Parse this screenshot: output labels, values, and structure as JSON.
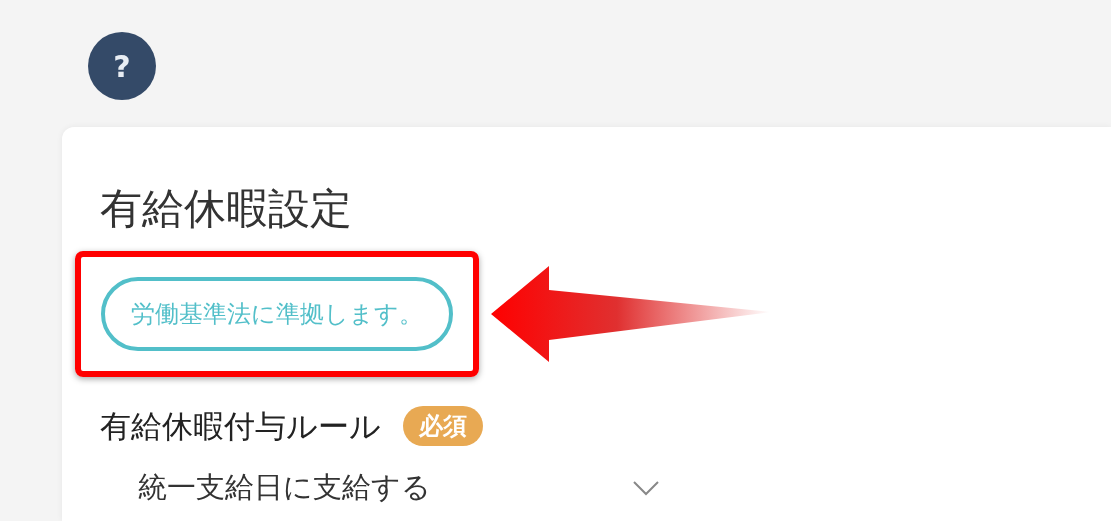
{
  "help_button": {
    "label": "?"
  },
  "card": {
    "title": "有給休暇設定",
    "compliance_button": {
      "label": "労働基準法に準拠します。"
    },
    "section": {
      "title": "有給休暇付与ルール",
      "badge": "必須"
    },
    "select": {
      "value": "統一支給日に支給する"
    }
  }
}
